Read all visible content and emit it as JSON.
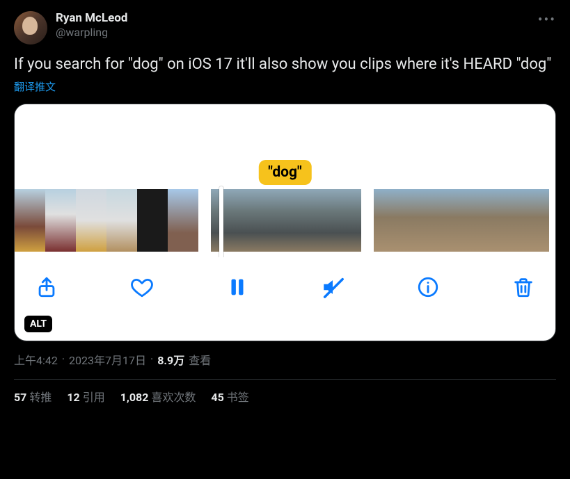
{
  "user": {
    "display_name": "Ryan McLeod",
    "handle": "@warpling"
  },
  "menu": {
    "more_label": "•••"
  },
  "post": {
    "text": "If you search for \"dog\" on iOS 17 it'll also show you clips where it's HEARD \"dog\"",
    "translate_label": "翻译推文"
  },
  "media": {
    "search_term_badge": "\"dog\"",
    "alt_badge": "ALT",
    "toolbar_icons": {
      "share": "share-icon",
      "like": "heart-icon",
      "pause": "pause-icon",
      "mute": "mute-icon",
      "info": "info-icon",
      "trash": "trash-icon"
    }
  },
  "meta": {
    "time": "上午4:42",
    "date": "2023年7月17日",
    "views_count": "8.9万",
    "views_label": "查看"
  },
  "stats": {
    "retweets": {
      "count": "57",
      "label": "转推"
    },
    "quotes": {
      "count": "12",
      "label": "引用"
    },
    "likes": {
      "count": "1,082",
      "label": "喜欢次数"
    },
    "bookmarks": {
      "count": "45",
      "label": "书签"
    }
  }
}
